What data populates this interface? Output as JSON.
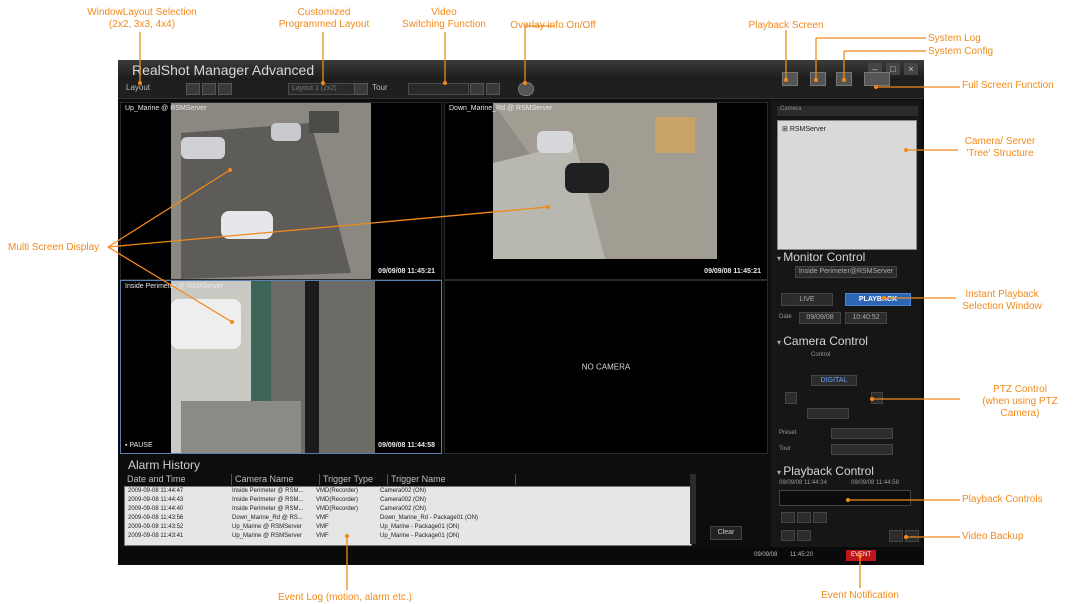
{
  "app": {
    "title": "RealShot Manager Advanced",
    "window_buttons": [
      "–",
      "□",
      "×"
    ]
  },
  "toolbar": {
    "layout_label": "Layout",
    "layout_options": [
      "2x2",
      "3x3",
      "4x4"
    ],
    "programmed_layout_value": "Layout 1 (2x2)",
    "tour_label": "Tour",
    "tour_value": "",
    "icons": [
      "overlay-info-icon",
      "playback-screen-icon",
      "system-log-icon",
      "system-config-icon",
      "full-screen-icon"
    ]
  },
  "panes": [
    {
      "label": "Up_Marine @ RSMServer",
      "timestamp": "09/09/08 11:45:21",
      "status": ""
    },
    {
      "label": "Down_Marine_Rd @ RSMServer",
      "timestamp": "09/09/08 11:45:21",
      "status": ""
    },
    {
      "label": "Inside Perimeter @ RSMServer",
      "timestamp": "09/09/08 11:44:58",
      "status": "▪ PAUSE"
    },
    {
      "label": "",
      "timestamp": "",
      "status": "",
      "nocam": "NO CAMERA"
    }
  ],
  "alarm_history": {
    "title": "Alarm History",
    "columns": [
      "Date and Time",
      "Camera Name",
      "Trigger Type",
      "Trigger Name"
    ],
    "rows": [
      [
        "2009-09-08 11:44:47",
        "Inside Perimeter @ RSM...",
        "VMD(Recorder)",
        "Camera002 (ON)"
      ],
      [
        "2009-09-08 11:44:43",
        "Inside Perimeter @ RSM...",
        "VMD(Recorder)",
        "Camera002 (ON)"
      ],
      [
        "2009-09-08 11:44:40",
        "Inside Perimeter @ RSM...",
        "VMD(Recorder)",
        "Camera002 (ON)"
      ],
      [
        "2009-09-08 11:43:56",
        "Down_Marine_Rd @ RS...",
        "VMF",
        "Down_Marine_Rd - Package01 (ON)"
      ],
      [
        "2009-09-08 11:43:52",
        "Up_Marine @ RSMServer",
        "VMF",
        "Up_Marine - Package01 (ON)"
      ],
      [
        "2009-09-08 11:43:41",
        "Up_Marine @ RSMServer",
        "VMF",
        "Up_Marine - Package01 (ON)"
      ]
    ],
    "clear_label": "Clear"
  },
  "right_panel": {
    "camera_tree_header": "Camera",
    "tree_root": "RSMServer",
    "monitor_control_title": "Monitor Control",
    "monitor_camera": "Inside Perimeter@RSMServer",
    "live_label": "LIVE",
    "playback_label": "PLAYBACK",
    "date_label": "Date",
    "date_value": "09/09/08",
    "time_value": "10:40:52",
    "camera_control_title": "Camera Control",
    "camera_tab": "Control",
    "digital_label": "DIGITAL",
    "preset_label": "Preset",
    "tour_label": "Tour",
    "playback_control_title": "Playback Control",
    "playback_start": "09/09/08 11:44:34",
    "playback_end": "09/09/08 11:44:58"
  },
  "statusbar": {
    "date": "09/09/08",
    "time": "11:45:20",
    "event_label": "EVENT"
  },
  "callouts": {
    "window_layout": "WindowLayout Selection\n(2x2, 3x3, 4x4)",
    "custom_layout": "Customized\nProgrammed Layout",
    "video_switch": "Video\nSwitching Function",
    "overlay": "Overlay info On/Off",
    "playback_screen": "Playback Screen",
    "system_log": "System Log",
    "system_config": "System Config",
    "full_screen": "Full Screen Function",
    "camera_tree": "Camera/ Server\n'Tree' Structure",
    "multi_screen": "Multi Screen Display",
    "instant_playback": "Instant Playback\nSelection Window",
    "ptz_control": "PTZ Control\n(when using PTZ Camera)",
    "playback_controls": "Playback Controls",
    "video_backup": "Video Backup",
    "event_log": "Event Log (motion, alarm etc.)",
    "event_notification": "Event Notification"
  },
  "colors": {
    "callout": "#f28a1a",
    "app_background": "#0d0d0d",
    "playback_button": "#2d66b5",
    "event_button": "#c0151a"
  }
}
